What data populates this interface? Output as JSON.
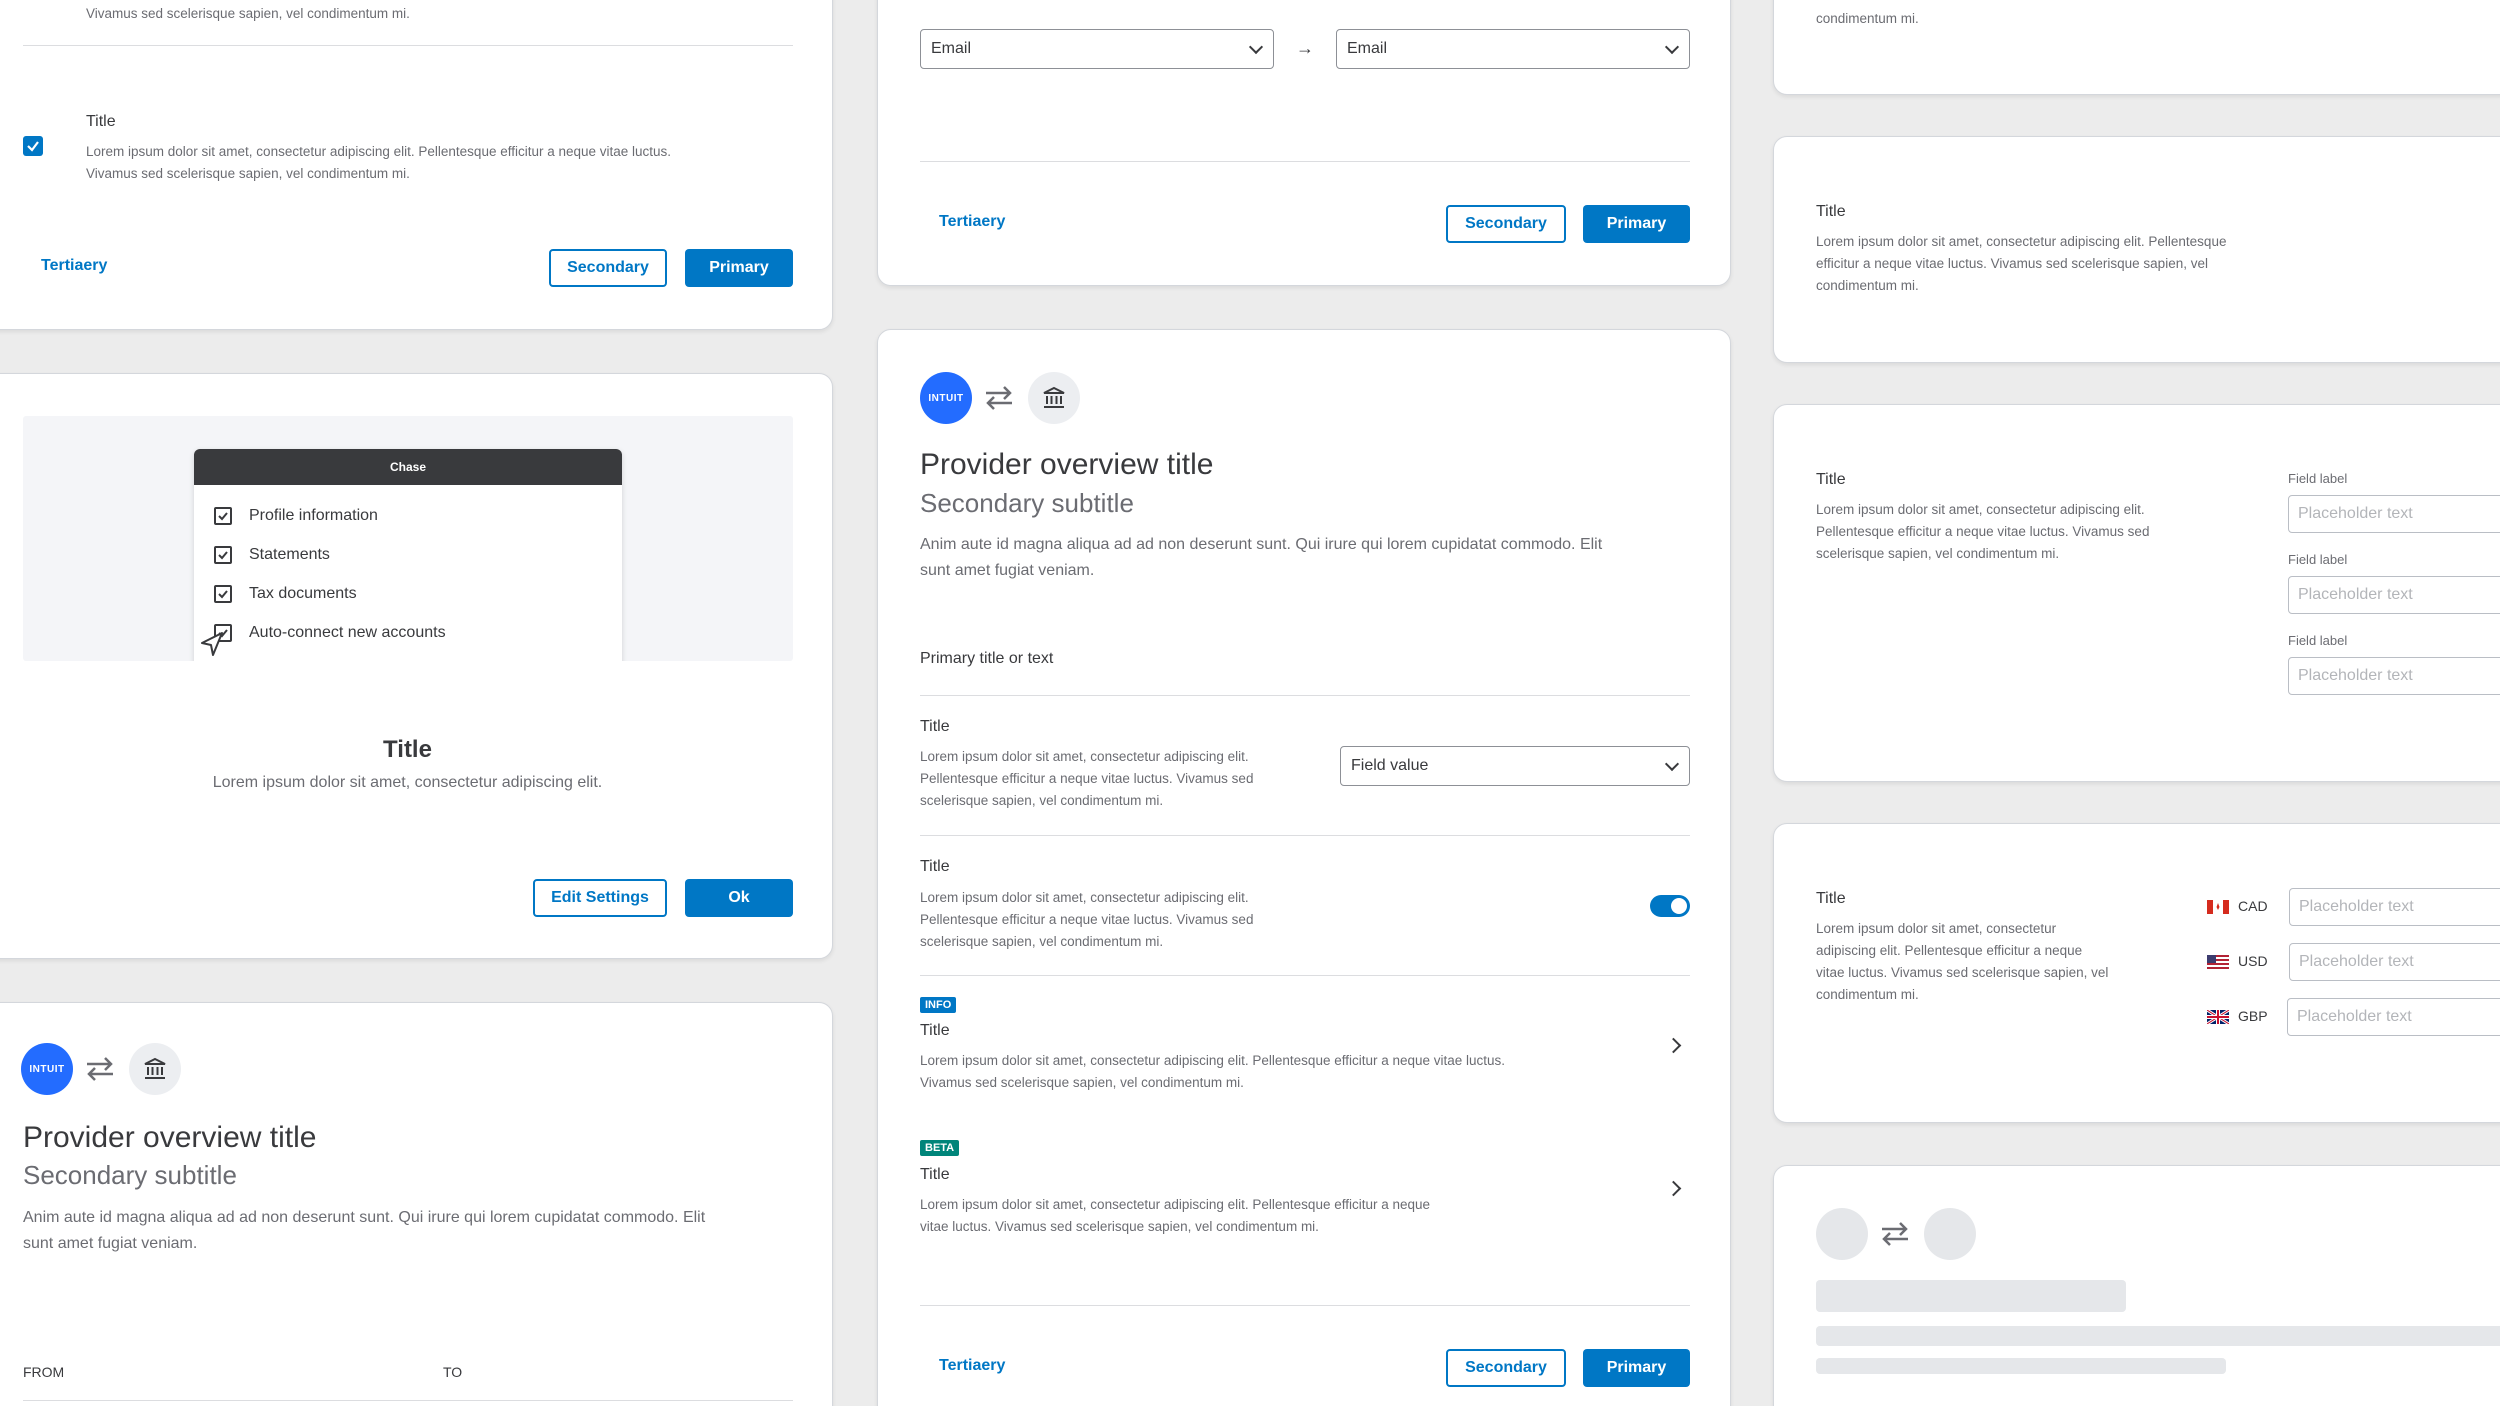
{
  "lorem_full": "Lorem ipsum dolor sit amet, consectetur adipiscing elit. Pellentesque efficitur a neque vitae luctus. Vivamus sed scelerisque sapien, vel condimentum mi.",
  "c1": {
    "top_text": "Vivamus sed scelerisque sapien, vel condimentum mi.",
    "item_title": "Title",
    "item_line1": "Lorem ipsum dolor sit amet, consectetur adipiscing elit. Pellentesque efficitur a neque vitae luctus.",
    "item_line2": "Vivamus sed scelerisque sapien, vel condimentum mi.",
    "tertiary": "Tertiaery",
    "secondary": "Secondary",
    "primary": "Primary"
  },
  "c2": {
    "popup_header": "Chase",
    "checks": [
      "Profile information",
      "Statements",
      "Tax documents",
      "Auto-connect new accounts"
    ],
    "title": "Title",
    "body": "Lorem ipsum dolor sit amet, consectetur adipiscing elit.",
    "edit_settings": "Edit Settings",
    "ok": "Ok"
  },
  "c3": {
    "logo_text": "INTUIT",
    "title": "Provider overview title",
    "subtitle": "Secondary subtitle",
    "body_line1": "Anim aute id magna aliqua ad ad non deserunt sunt. Qui irure qui lorem cupidatat commodo. Elit",
    "body_line2": "sunt amet fugiat veniam.",
    "from": "FROM",
    "to": "TO"
  },
  "c4": {
    "select_left": "Email",
    "arrow": "→",
    "select_right": "Email",
    "tertiary": "Tertiaery",
    "secondary": "Secondary",
    "primary": "Primary"
  },
  "c5": {
    "logo_text": "INTUIT",
    "title": "Provider overview title",
    "subtitle": "Secondary subtitle",
    "body_line1": "Anim aute id magna aliqua ad ad non deserunt sunt. Qui irure qui lorem cupidatat commodo. Elit",
    "body_line2": "sunt amet fugiat veniam.",
    "section_title": "Primary title or text",
    "row1_title": "Title",
    "row1_lines": [
      "Lorem ipsum dolor sit amet, consectetur adipiscing elit.",
      "Pellentesque efficitur a neque vitae luctus. Vivamus sed",
      "scelerisque sapien, vel condimentum mi."
    ],
    "row1_select": "Field value",
    "row2_title": "Title",
    "row2_lines": [
      "Lorem ipsum dolor sit amet, consectetur adipiscing elit.",
      "Pellentesque efficitur a neque vitae luctus. Vivamus sed",
      "scelerisque sapien, vel condimentum mi."
    ],
    "row2_toggle_on": true,
    "row3_badge": "INFO",
    "row3_title": "Title",
    "row3_lines": [
      "Lorem ipsum dolor sit amet, consectetur adipiscing elit. Pellentesque efficitur a neque vitae luctus.",
      "Vivamus sed scelerisque sapien, vel condimentum mi."
    ],
    "row4_badge": "BETA",
    "row4_title": "Title",
    "row4_lines": [
      "Lorem ipsum dolor sit amet, consectetur adipiscing elit. Pellentesque efficitur a neque",
      "vitae luctus. Vivamus sed scelerisque sapien, vel condimentum mi."
    ],
    "tertiary": "Tertiaery",
    "secondary": "Secondary",
    "primary": "Primary"
  },
  "c6": {
    "text_line": "condimentum mi."
  },
  "c7": {
    "title": "Title",
    "lines": [
      "Lorem ipsum dolor sit amet, consectetur adipiscing elit. Pellentesque",
      "efficitur a neque vitae luctus. Vivamus sed scelerisque sapien, vel",
      "condimentum mi."
    ]
  },
  "c8": {
    "title": "Title",
    "lines": [
      "Lorem ipsum dolor sit amet, consectetur adipiscing elit.",
      "Pellentesque efficitur a neque vitae luctus. Vivamus sed",
      "scelerisque sapien, vel condimentum mi."
    ],
    "field_label": "Field label",
    "placeholder": "Placeholder text"
  },
  "c9": {
    "title": "Title",
    "lines": [
      "Lorem ipsum dolor sit amet, consectetur",
      "adipiscing elit. Pellentesque efficitur a neque",
      "vitae luctus. Vivamus sed scelerisque sapien, vel",
      "condimentum mi."
    ],
    "currencies": [
      "CAD",
      "USD",
      "GBP"
    ],
    "placeholder": "Placeholder text"
  },
  "colors": {
    "primary": "#0077c5",
    "intuit_blue": "#236cff",
    "info_badge": "#0077c5",
    "beta_badge": "#00857a"
  }
}
